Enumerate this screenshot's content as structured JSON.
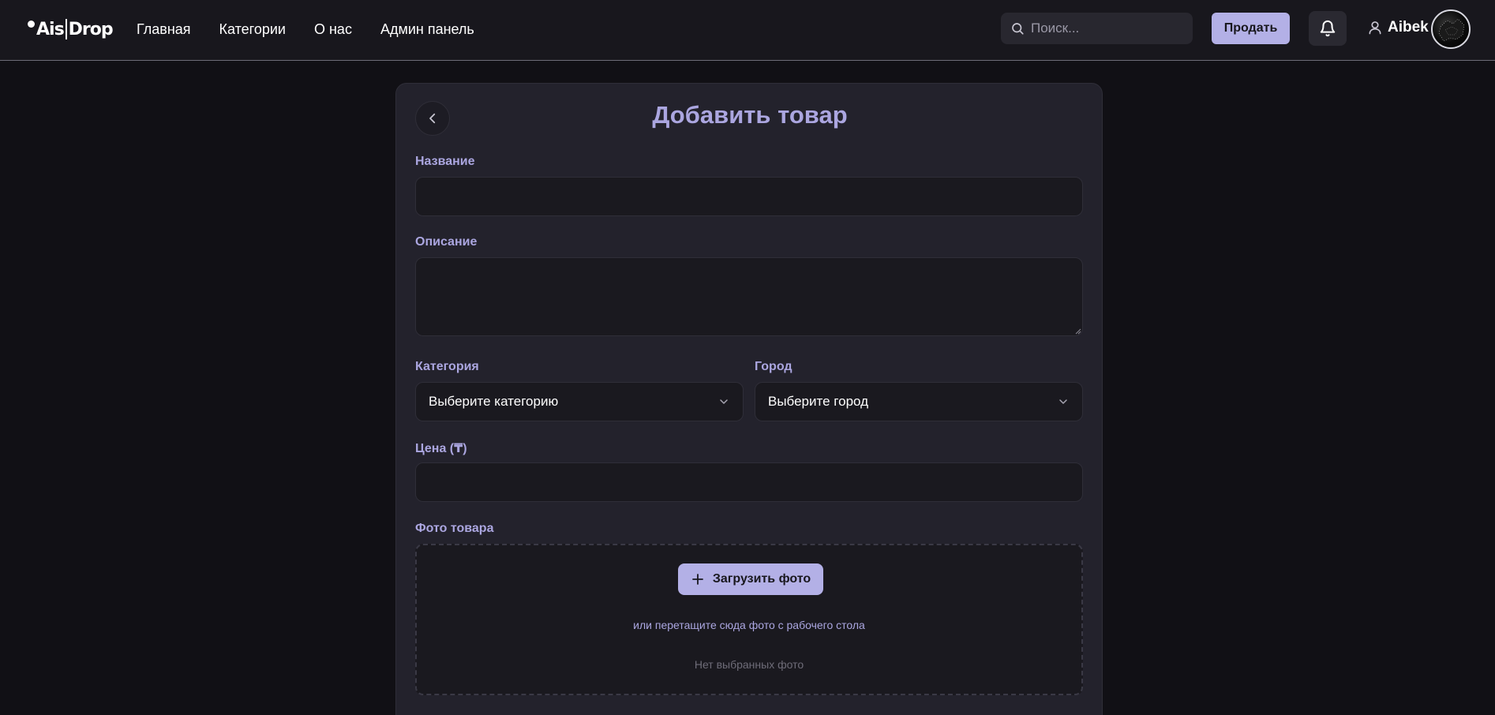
{
  "header": {
    "logo": {
      "left": "Ais",
      "right": "Drop"
    },
    "nav": [
      "Главная",
      "Категории",
      "О нас",
      "Админ панель"
    ],
    "search_placeholder": "Поиск...",
    "sell_label": "Продать",
    "user_name": "Aibek"
  },
  "form": {
    "title": "Добавить товар",
    "name_label": "Название",
    "name_value": "",
    "description_label": "Описание",
    "description_value": "",
    "category_label": "Категория",
    "category_value": "Выберите категорию",
    "city_label": "Город",
    "city_value": "Выберите город",
    "price_label": "Цена (₸)",
    "price_value": "",
    "photo_label": "Фото товара",
    "upload_label": "Загрузить фото",
    "drop_hint": "или перетащите сюда фото с рабочего стола",
    "no_photo": "Нет выбранных фото"
  },
  "colors": {
    "accent": "#b3b0e6",
    "label": "#aba6e0",
    "background": "#111015",
    "card": "#23222c"
  }
}
